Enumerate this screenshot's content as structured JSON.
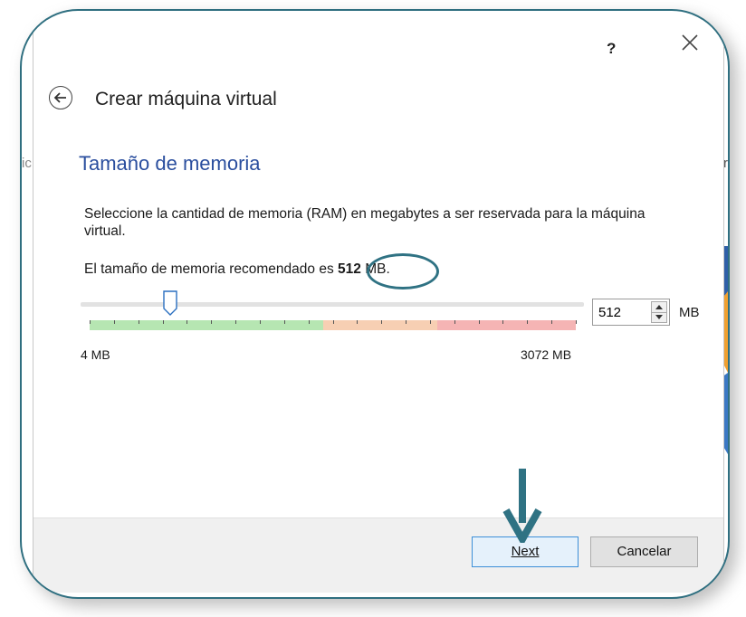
{
  "window": {
    "help_label": "?",
    "close_label": "✕"
  },
  "wizard": {
    "title": "Crear máquina virtual",
    "back_icon": "back-arrow-icon"
  },
  "section": {
    "title": "Tamaño de memoria",
    "description": "Seleccione la cantidad de memoria (RAM) en megabytes a ser reservada para la máquina virtual.",
    "recommend_prefix": "El tamaño de memoria recomendado es ",
    "recommend_value": "512",
    "recommend_suffix": " MB."
  },
  "memory": {
    "value": 512,
    "value_text": "512",
    "min": 4,
    "max": 3072,
    "min_label": "4 MB",
    "max_label": "3072 MB",
    "unit": "MB",
    "zones": {
      "green_until_fraction": 0.48,
      "orange_until_fraction": 0.715
    },
    "tick_count": 20
  },
  "footer": {
    "next_label": "Next",
    "cancel_label": "Cancelar"
  },
  "background": {
    "left_fragment": "ic",
    "right_fragment": "ar"
  },
  "colors": {
    "accent_title": "#2a4e9e",
    "callout": "#2f7283",
    "zone_green": "#b6e6b2",
    "zone_orange": "#f7cfb3",
    "zone_red": "#f5b4b4",
    "next_border": "#3c8fd8"
  }
}
